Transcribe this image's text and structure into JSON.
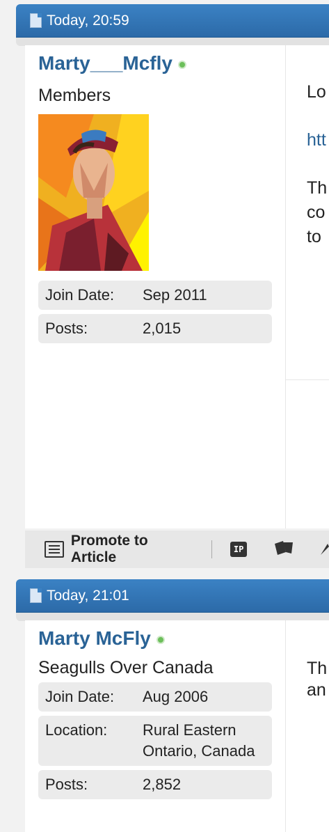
{
  "posts": [
    {
      "date": "Today, 20:59",
      "username": "Marty___Mcfly",
      "usertitle": "Members",
      "info": [
        {
          "label": "Join Date:",
          "value": "Sep 2011"
        },
        {
          "label": "Posts:",
          "value": "2,015"
        }
      ],
      "content_lines": [
        "Lo",
        "htt",
        "Th",
        "co",
        "to"
      ]
    },
    {
      "date": "Today, 21:01",
      "username": "Marty McFly",
      "usertitle": "Seagulls Over Canada",
      "info": [
        {
          "label": "Join Date:",
          "value": "Aug 2006"
        },
        {
          "label": "Location:",
          "value": "Rural Eastern Ontario, Canada"
        },
        {
          "label": "Posts:",
          "value": "2,852"
        }
      ],
      "content_lines": [
        "Th",
        "an"
      ]
    }
  ],
  "toolbar": {
    "promote_label": "Promote to Article",
    "ip_label": "IP"
  },
  "colors": {
    "header": "#3b82c4",
    "username": "#2a6396",
    "online": "#6cbf5a"
  }
}
